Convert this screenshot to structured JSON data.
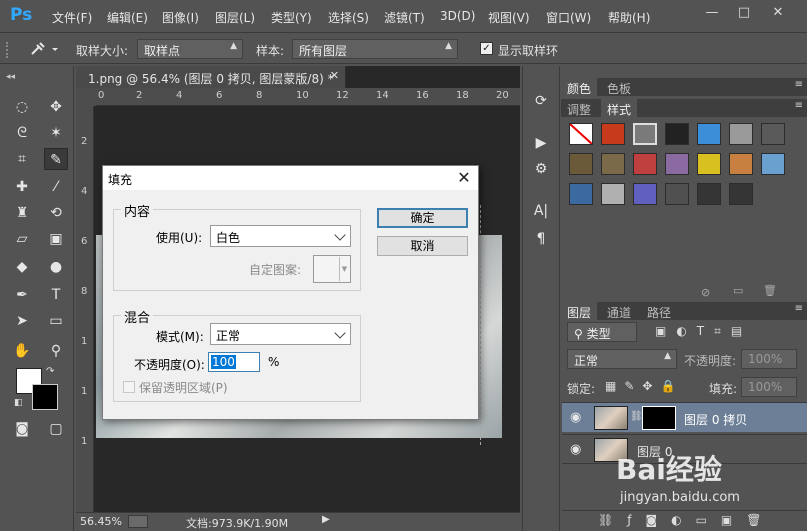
{
  "app": {
    "logo": "Ps"
  },
  "menu": [
    "文件(F)",
    "编辑(E)",
    "图像(I)",
    "图层(L)",
    "类型(Y)",
    "选择(S)",
    "滤镜(T)",
    "3D(D)",
    "视图(V)",
    "窗口(W)",
    "帮助(H)"
  ],
  "window_buttons": {
    "minimize": "—",
    "restore": "□",
    "close": "✕"
  },
  "options": {
    "sample_size_label": "取样大小:",
    "sample_size_value": "取样点",
    "sample_label": "样本:",
    "sample_value": "所有图层",
    "show_ring_label": "显示取样环",
    "show_ring_checked": true
  },
  "document": {
    "tab_title": "1.png @ 56.4% (图层 0 拷贝, 图层蒙版/8) *",
    "zoom": "56.45%",
    "doc_info": "文档:973.9K/1.90M",
    "ruler_top": [
      "0",
      "2",
      "4",
      "6",
      "8",
      "10",
      "12",
      "14",
      "16",
      "18",
      "20"
    ],
    "ruler_left": [
      "2",
      "4",
      "6",
      "8",
      "1",
      "1",
      "1"
    ]
  },
  "panels": {
    "top_tabs": [
      "颜色",
      "色板"
    ],
    "mid_tabs": [
      "调整",
      "样式"
    ],
    "layers_tabs": [
      "图层",
      "通道",
      "路径"
    ],
    "kind_filter": "类型",
    "blend_mode": "正常",
    "opacity_label": "不透明度:",
    "opacity_value": "100%",
    "lock_label": "锁定:",
    "fill_label": "填充:",
    "fill_value": "100%",
    "styles_colors": [
      "#ffffff",
      "#c83a1c",
      "#7a7a7a",
      "#222222",
      "#3a8fd8",
      "#9a9a9a",
      "#5a5a5a",
      "#6b5a3a",
      "#7a6a4a",
      "#c04040",
      "#8a6aa0",
      "#d8c020",
      "#c88040",
      "#6aa0d0",
      "#3a6aa0",
      "#b0b0b0",
      "#6060c0",
      "#505050",
      "#353535",
      "#353535"
    ],
    "layers": [
      {
        "name": "图层 0 拷贝",
        "selected": true
      },
      {
        "name": "图层 0",
        "selected": false
      }
    ]
  },
  "dialog": {
    "title": "填充",
    "content_group": "内容",
    "use_label": "使用(U):",
    "use_value": "白色",
    "custom_pattern_label": "自定图案:",
    "blend_group": "混合",
    "mode_label": "模式(M):",
    "mode_value": "正常",
    "opacity_label": "不透明度(O):",
    "opacity_value": "100",
    "percent": "%",
    "preserve_label": "保留透明区域(P)",
    "ok": "确定",
    "cancel": "取消"
  },
  "watermark": {
    "text": "Bai经验",
    "url": "jingyan.baidu.com"
  }
}
